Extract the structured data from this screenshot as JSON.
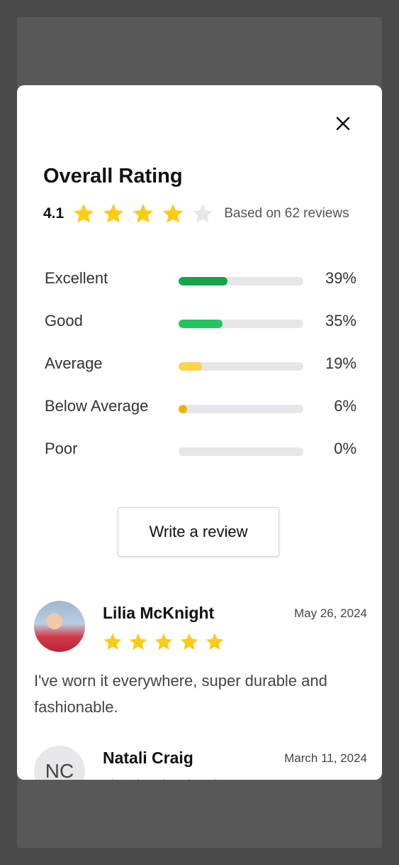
{
  "modal": {
    "title": "Overall Rating",
    "rating": {
      "value": "4.1",
      "stars_filled": 4,
      "stars_total": 5,
      "count_text": "Based on 62 reviews"
    },
    "breakdown": [
      {
        "label": "Excellent",
        "percent": 39,
        "percent_text": "39%",
        "color": "#16a34a"
      },
      {
        "label": "Good",
        "percent": 35,
        "percent_text": "35%",
        "color": "#22c55e"
      },
      {
        "label": "Average",
        "percent": 19,
        "percent_text": "19%",
        "color": "#fcd34d"
      },
      {
        "label": "Below Average",
        "percent": 6,
        "percent_text": "6%",
        "color": "#eab308"
      },
      {
        "label": "Poor",
        "percent": 0,
        "percent_text": "0%",
        "color": "#ef4444"
      }
    ],
    "write_review_label": "Write a review",
    "reviews": [
      {
        "name": "Lilia McKnight",
        "date": "May 26, 2024",
        "stars": 5,
        "text": "I've worn it everywhere, super durable and fashionable.",
        "avatar": "photo"
      },
      {
        "name": "Natali Craig",
        "date": "March 11, 2024",
        "stars": 5,
        "initials": "NC",
        "avatar": "initials"
      }
    ]
  },
  "colors": {
    "star_filled": "#facc15",
    "star_empty": "#e5e7eb",
    "overlay": "#4a4a4a"
  },
  "icons": {
    "close": "close-icon",
    "star": "star-icon"
  }
}
